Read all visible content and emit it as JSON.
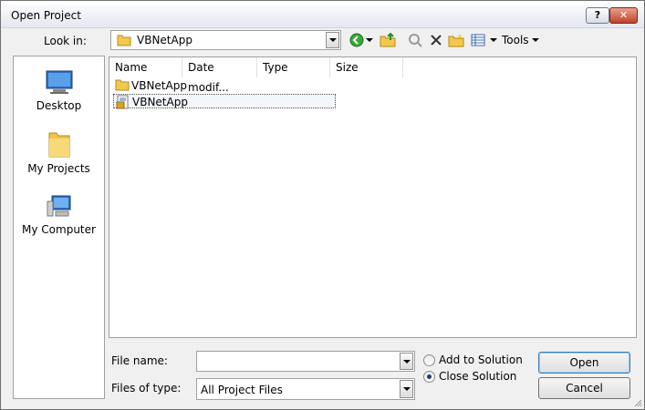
{
  "window": {
    "title": "Open Project"
  },
  "titlebar_buttons": {
    "help": "?",
    "close": "✕"
  },
  "look_in": {
    "label": "Look in:",
    "value": "VBNetApp"
  },
  "toolbar": {
    "tools_label": "Tools"
  },
  "places": [
    {
      "label": "Desktop",
      "icon": "desktop-icon"
    },
    {
      "label": "My Projects",
      "icon": "folder-icon"
    },
    {
      "label": "My Computer",
      "icon": "computer-icon"
    }
  ],
  "columns": [
    "Name",
    "Date modif...",
    "Type",
    "Size"
  ],
  "files": [
    {
      "name": "VBNetApp",
      "icon": "folder-icon",
      "selected": false
    },
    {
      "name": "VBNetApp",
      "icon": "vb-project-icon",
      "selected": true
    }
  ],
  "file_name": {
    "label": "File name:",
    "value": ""
  },
  "files_of_type": {
    "label": "Files of type:",
    "value": "All Project Files"
  },
  "radios": {
    "add": "Add to Solution",
    "close": "Close Solution",
    "selected": "close"
  },
  "buttons": {
    "open": "Open",
    "cancel": "Cancel"
  },
  "colors": {
    "accent": "#3c7fb1",
    "selected_outline": "#505050"
  }
}
